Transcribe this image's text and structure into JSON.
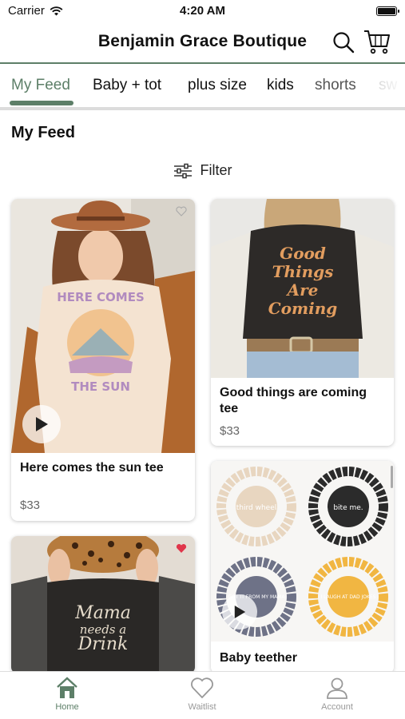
{
  "status_bar": {
    "carrier": "Carrier",
    "time": "4:20 AM"
  },
  "header": {
    "title": "Benjamin Grace Boutique",
    "icons": [
      "search-icon",
      "cart-icon"
    ]
  },
  "tabs": [
    {
      "label": "My Feed",
      "active": true
    },
    {
      "label": "Baby + tot",
      "active": false
    },
    {
      "label": "plus size",
      "active": false
    },
    {
      "label": "kids",
      "active": false
    },
    {
      "label": "shorts",
      "active": false
    },
    {
      "label": "sw",
      "active": false
    }
  ],
  "section_title": "My Feed",
  "filter_label": "Filter",
  "products": [
    {
      "name": "Here comes the sun tee",
      "price": "$33",
      "has_video": true,
      "wishlisted": false,
      "print_text": [
        "HERE COMES",
        "THE SUN"
      ]
    },
    {
      "name": "Good things are coming tee",
      "price": "$33",
      "has_video": false,
      "wishlisted": false,
      "print_text": [
        "Good",
        "Things",
        "Are",
        "Coming"
      ]
    },
    {
      "name": "Mama needs a Drink",
      "price": "",
      "has_video": false,
      "wishlisted": true,
      "print_text": [
        "Mama",
        "needs a",
        "Drink"
      ]
    },
    {
      "name": "Baby teether",
      "price": "",
      "has_video": true,
      "wishlisted": false,
      "print_text": [
        "third wheel",
        "bite me.",
        "GOT IT FROM MY MAMA",
        "I LAUGH AT DAD JOKES"
      ]
    }
  ],
  "bottom_nav": [
    {
      "label": "Home",
      "icon": "home-icon",
      "active": true
    },
    {
      "label": "Waitlist",
      "icon": "heart-icon",
      "active": false
    },
    {
      "label": "Account",
      "icon": "account-icon",
      "active": false
    }
  ],
  "colors": {
    "accent": "#5d7f68",
    "heart_active": "#e0364b",
    "price": "#666666"
  }
}
